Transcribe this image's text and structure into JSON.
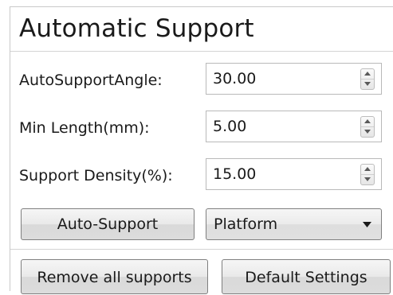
{
  "panel": {
    "title": "Automatic Support"
  },
  "fields": [
    {
      "label": "AutoSupportAngle:",
      "value": "30.00"
    },
    {
      "label": "Min Length(mm):",
      "value": "5.00"
    },
    {
      "label": "Support Density(%):",
      "value": "15.00"
    }
  ],
  "actions": {
    "auto_support_label": "Auto-Support",
    "placement_selected": "Platform",
    "remove_all_label": "Remove all supports",
    "default_settings_label": "Default Settings"
  },
  "icons": {
    "spin_up": "spin-up-arrow-icon",
    "spin_down": "spin-down-arrow-icon",
    "dropdown": "dropdown-arrow-icon"
  }
}
